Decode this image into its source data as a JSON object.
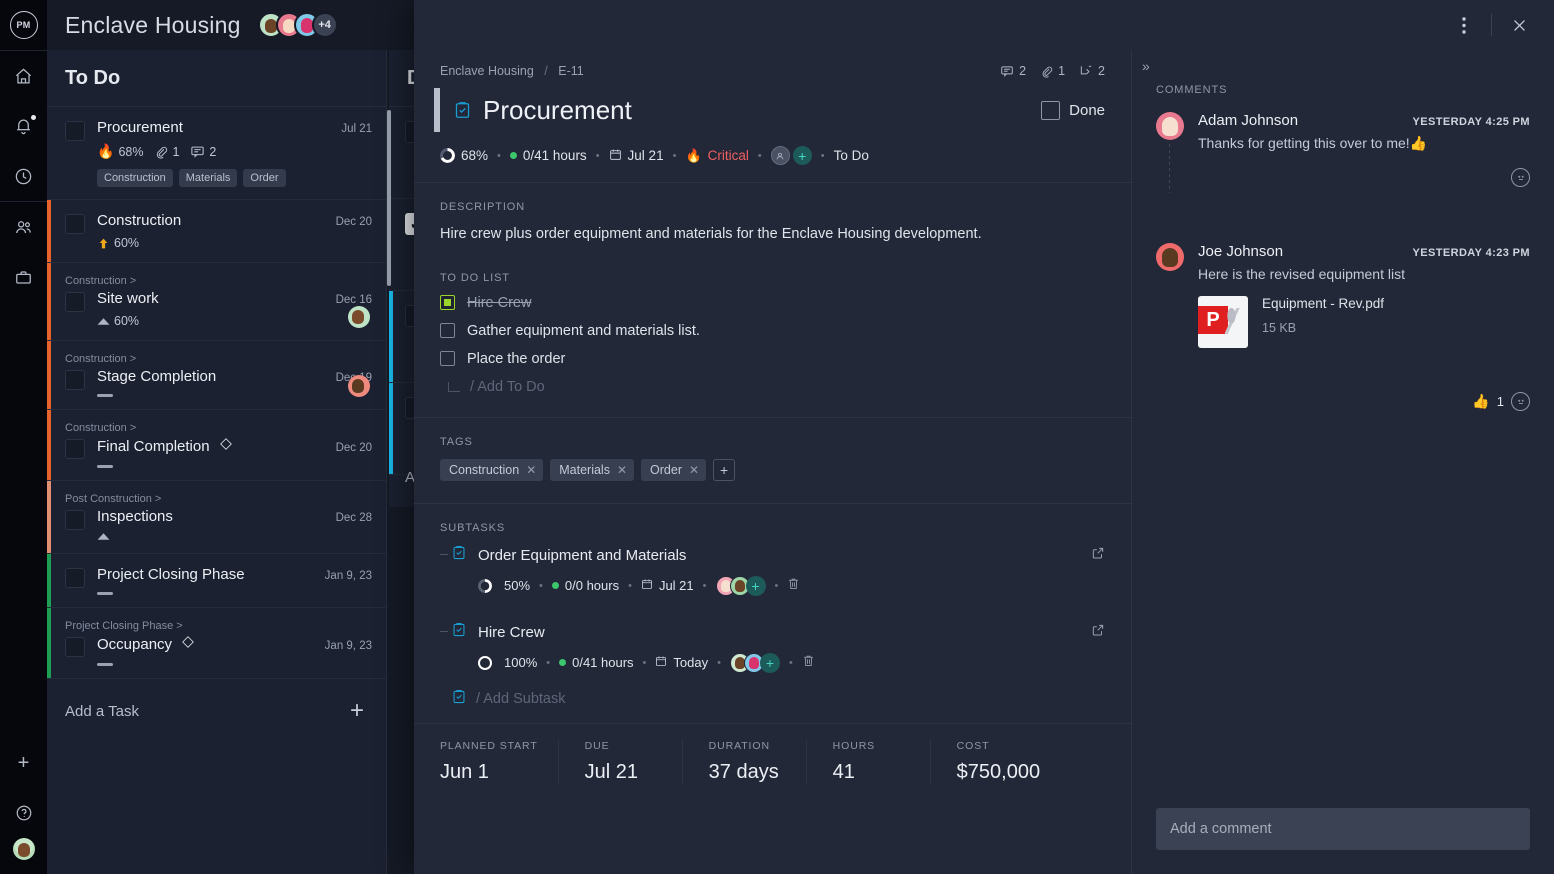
{
  "app": {
    "logo_text": "PM",
    "project_title": "Enclave Housing",
    "avatar_overflow": "+4"
  },
  "rail": {
    "items": [
      {
        "name": "home-icon",
        "label": "Home"
      },
      {
        "name": "bell-icon",
        "label": "Notifications"
      },
      {
        "name": "clock-icon",
        "label": "Recent"
      },
      {
        "name": "people-icon",
        "label": "Team"
      },
      {
        "name": "briefcase-icon",
        "label": "Portfolio"
      }
    ],
    "add_label": "+",
    "help_label": "?"
  },
  "board": {
    "columns": [
      {
        "title": "To Do"
      },
      {
        "title": "D"
      }
    ],
    "add_task_label": "Add a Task",
    "add_task_plus": "+",
    "frag_add_label": "Ad",
    "cards": [
      {
        "title": "Procurement",
        "date": "Jul 21",
        "parent": "",
        "percent": "68%",
        "attachments": "1",
        "comments": "2",
        "priority_icon": "fire-icon",
        "bar": "bar-none",
        "tags": [
          "Construction",
          "Materials",
          "Order"
        ]
      },
      {
        "title": "Construction",
        "date": "Dec 20",
        "parent": "",
        "percent": "60%",
        "priority_icon": "up-arrow-icon",
        "bar": "bar-orange",
        "tags": []
      },
      {
        "title": "Site work",
        "date": "Dec 16",
        "parent": "Construction >",
        "percent": "60%",
        "priority_icon": "triangle-icon",
        "bar": "bar-orange",
        "avatar": "cav-g",
        "tags": []
      },
      {
        "title": "Stage Completion",
        "date": "Dec 19",
        "parent": "Construction >",
        "percent": "",
        "priority_icon": "dash-icon",
        "bar": "bar-orange",
        "avatar": "cav-r",
        "tags": []
      },
      {
        "title": "Final Completion",
        "date": "Dec 20",
        "parent": "Construction >",
        "percent": "",
        "priority_icon": "dash-icon",
        "bar": "bar-orange",
        "milestone": true,
        "tags": []
      },
      {
        "title": "Inspections",
        "date": "Dec 28",
        "parent": "Post Construction >",
        "percent": "",
        "priority_icon": "triangle-icon",
        "bar": "bar-orange-lite",
        "tags": []
      },
      {
        "title": "Project Closing Phase",
        "date": "Jan 9, 23",
        "parent": "",
        "percent": "",
        "priority_icon": "dash-icon",
        "bar": "bar-green",
        "tags": []
      },
      {
        "title": "Occupancy",
        "date": "Jan 9, 23",
        "parent": "Project Closing Phase >",
        "percent": "",
        "priority_icon": "dash-icon",
        "bar": "bar-green",
        "milestone": true,
        "tags": []
      }
    ]
  },
  "modal": {
    "breadcrumb": {
      "project": "Enclave Housing",
      "separator": "/",
      "id": "E-11"
    },
    "counters": {
      "comments": "2",
      "attachments": "1",
      "subtasks": "2"
    },
    "title": "Procurement",
    "done_label": "Done",
    "meta": {
      "percent": "68%",
      "hours": "0/41 hours",
      "date": "Jul 21",
      "priority": "Critical",
      "status": "To Do"
    },
    "description": {
      "label": "DESCRIPTION",
      "text": "Hire crew plus order equipment and materials for the Enclave Housing development."
    },
    "todo_list": {
      "label": "TO DO LIST",
      "add_placeholder": "/ Add To Do",
      "items": [
        {
          "text": "Hire Crew",
          "checked": true
        },
        {
          "text": "Gather equipment and materials list.",
          "checked": false
        },
        {
          "text": "Place the order",
          "checked": false
        }
      ]
    },
    "tags": {
      "label": "TAGS",
      "items": [
        "Construction",
        "Materials",
        "Order"
      ],
      "add_label": "+"
    },
    "subtasks": {
      "label": "SUBTASKS",
      "add_placeholder": "/ Add Subtask",
      "items": [
        {
          "title": "Order Equipment and Materials",
          "percent": "50%",
          "hours": "0/0 hours",
          "date": "Jul 21",
          "ring": "50"
        },
        {
          "title": "Hire Crew",
          "percent": "100%",
          "hours": "0/41 hours",
          "date": "Today",
          "ring": "100"
        }
      ]
    },
    "stats": [
      {
        "label": "PLANNED START",
        "value": "Jun 1"
      },
      {
        "label": "DUE",
        "value": "Jul 21"
      },
      {
        "label": "DURATION",
        "value": "37 days"
      },
      {
        "label": "HOURS",
        "value": "41"
      },
      {
        "label": "COST",
        "value": "$750,000"
      }
    ]
  },
  "comments_panel": {
    "collapse_label": "»",
    "label": "COMMENTS",
    "input_placeholder": "Add a comment",
    "items": [
      {
        "author": "Adam Johnson",
        "time": "YESTERDAY 4:25 PM",
        "text": "Thanks for getting this over to me!👍",
        "avatar": "p",
        "attachment": null,
        "reaction_count": ""
      },
      {
        "author": "Joe Johnson",
        "time": "YESTERDAY 4:23 PM",
        "text": "Here is the revised equipment list",
        "avatar": "r",
        "attachment": {
          "name": "Equipment - Rev.pdf",
          "size": "15 KB"
        },
        "reaction_count": "1"
      }
    ]
  },
  "colors": {
    "accent_blue": "#19b8e8",
    "priority_critical": "#f06060",
    "bar_orange": "#e8632b",
    "bar_green": "#1f9d55",
    "teal": "#45d6c3",
    "green_dot": "#3cc66d"
  }
}
